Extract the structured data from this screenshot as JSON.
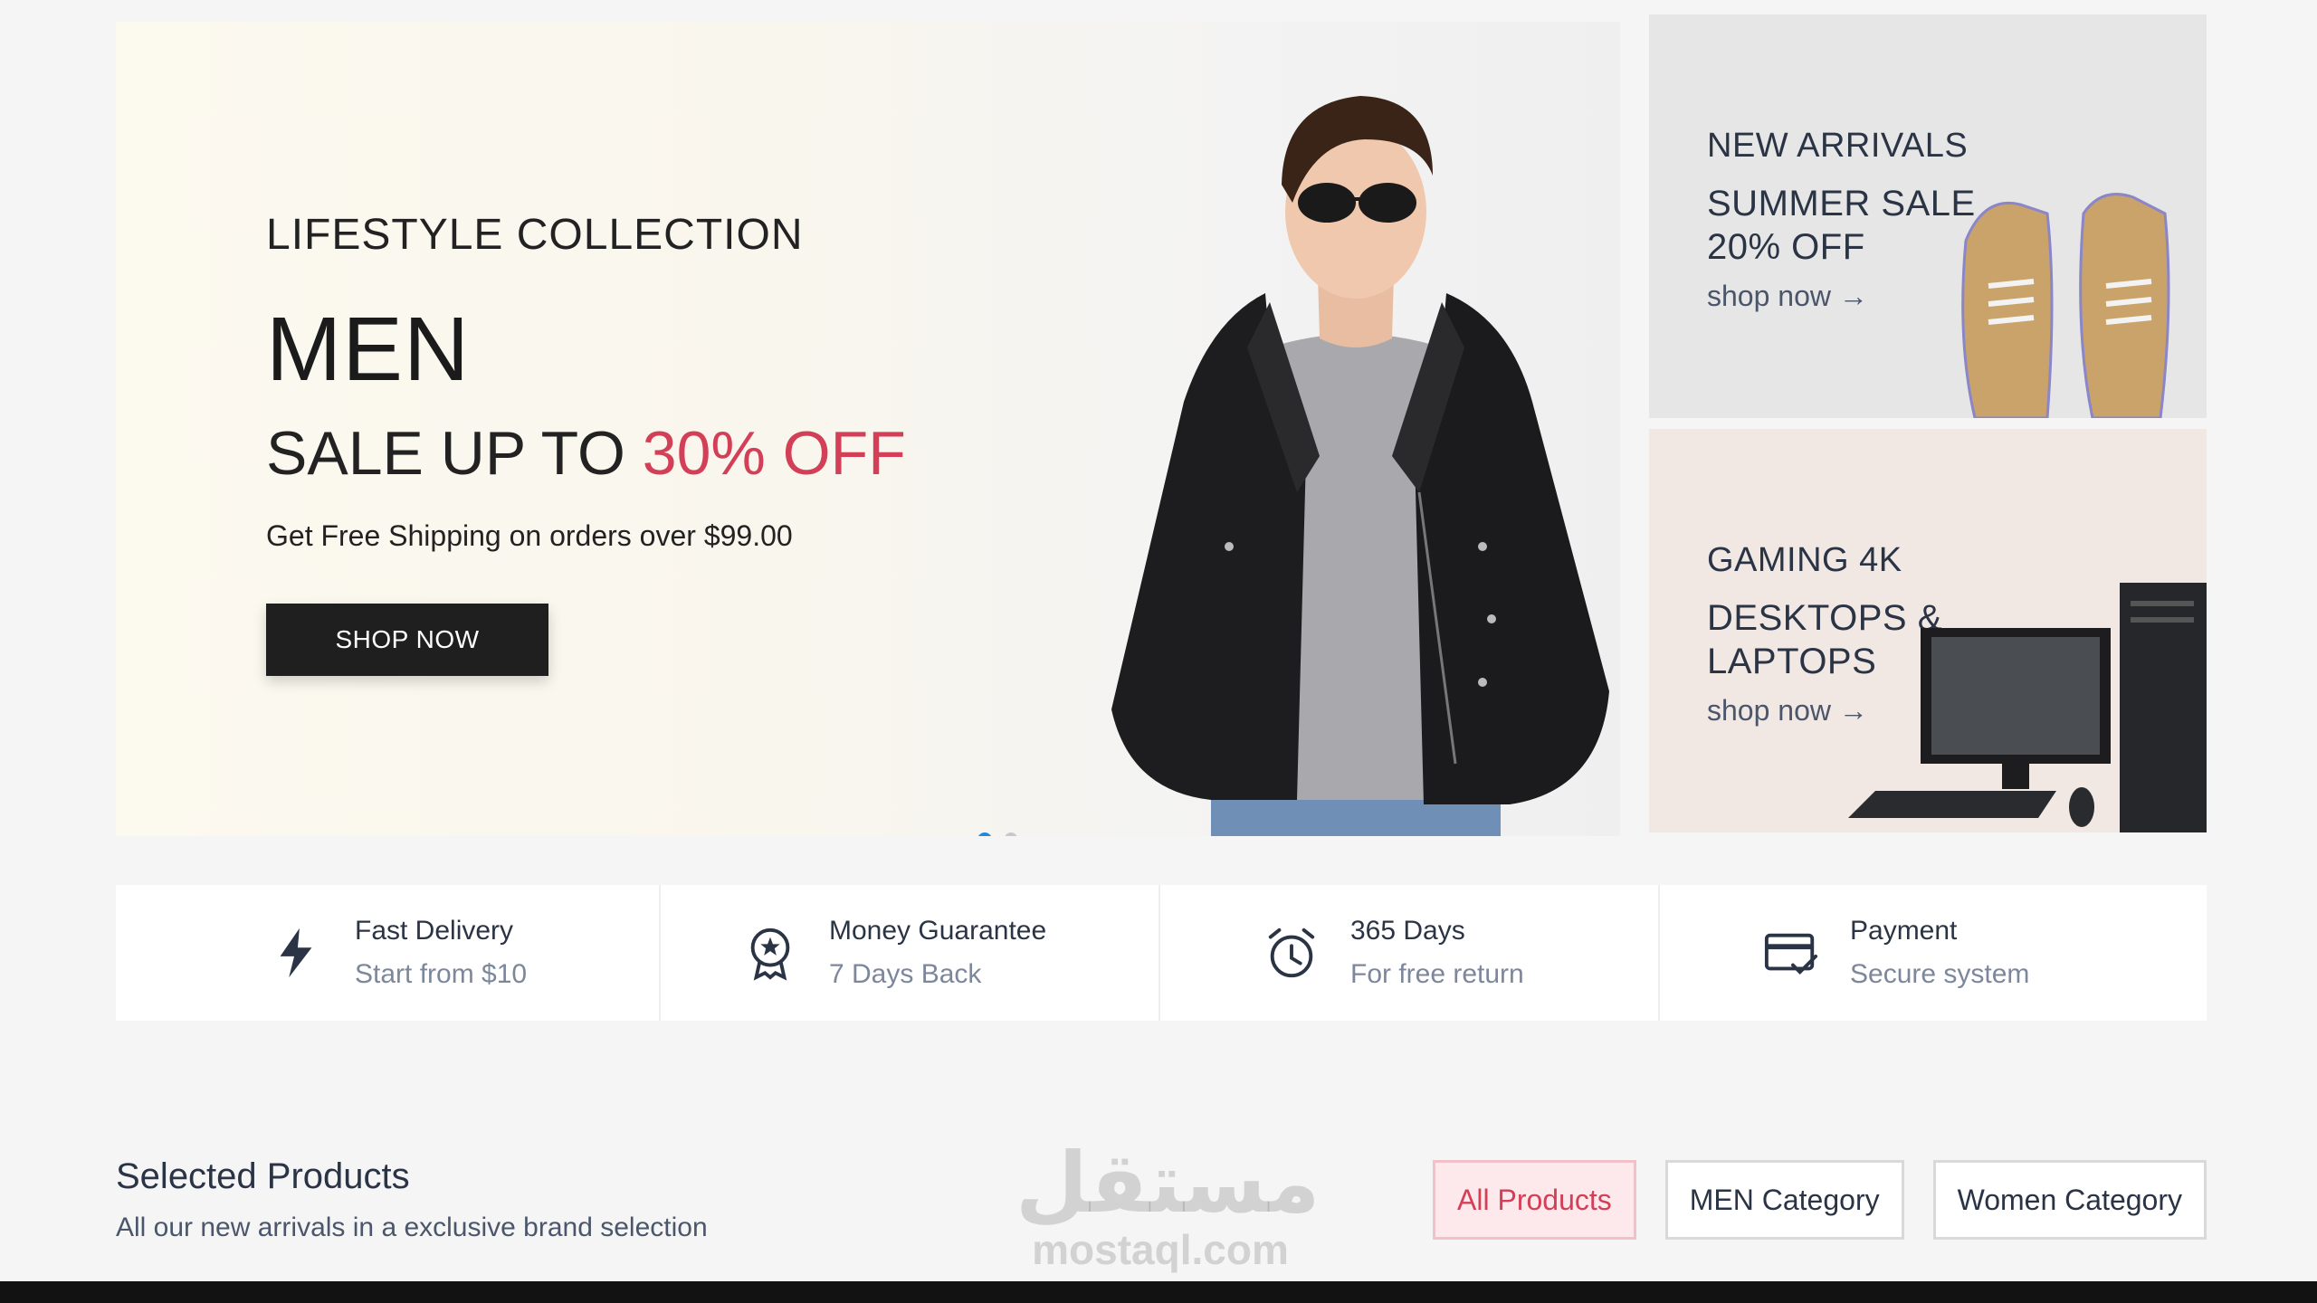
{
  "hero": {
    "eyebrow": "LIFESTYLE COLLECTION",
    "title": "MEN",
    "sale_prefix": "SALE UP TO ",
    "sale_accent": "30% OFF",
    "subtitle": "Get Free Shipping on orders over $99.00",
    "button_label": "SHOP NOW",
    "slides_total": 2,
    "active_slide": 1
  },
  "promos": [
    {
      "eyebrow": "NEW ARRIVALS",
      "title": "SUMMER SALE 20% OFF",
      "link": "shop now →"
    },
    {
      "eyebrow": "GAMING 4K",
      "title": "DESKTOPS & LAPTOPS",
      "link": "shop now →"
    }
  ],
  "features": [
    {
      "icon": "lightning-icon",
      "title": "Fast Delivery",
      "subtitle": "Start from $10"
    },
    {
      "icon": "medal-icon",
      "title": "Money Guarantee",
      "subtitle": "7 Days Back"
    },
    {
      "icon": "alarm-clock-icon",
      "title": "365 Days",
      "subtitle": "For free return"
    },
    {
      "icon": "credit-card-check-icon",
      "title": "Payment",
      "subtitle": "Secure system"
    }
  ],
  "products": {
    "title": "Selected Products",
    "subtitle": "All our new arrivals in a exclusive brand selection",
    "filters": [
      "All Products",
      "MEN Category",
      "Women Category"
    ],
    "active_filter": "All Products"
  },
  "watermark": {
    "arabic": "مستقل",
    "latin": "mostaql.com"
  },
  "colors": {
    "accent": "#d23f57",
    "dark_button": "#1f1f1f",
    "slider_dot": "#1e88e5"
  }
}
